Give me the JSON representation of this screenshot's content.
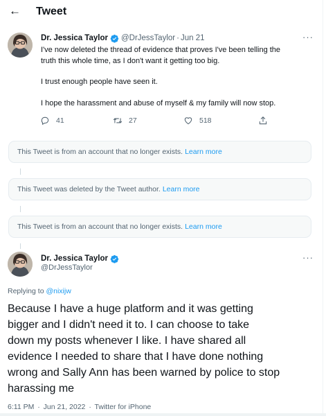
{
  "header": {
    "back_icon": "arrow-left-icon",
    "title": "Tweet"
  },
  "tweet1": {
    "name": "Dr. Jessica Taylor",
    "handle": "@DrJessTaylor",
    "date": "Jun 21",
    "dot": "·",
    "more": "···",
    "lines": [
      "I've now deleted the thread of evidence that proves I've been telling the",
      "truth this whole time, as I don't want it getting too big.",
      "I trust enough people have seen it.",
      "I hope the harassment and abuse of myself & my family will now stop."
    ],
    "replies": "41",
    "retweets": "27",
    "likes": "518"
  },
  "notices": [
    {
      "text": "This Tweet is from an account that no longer exists.",
      "link": "Learn more"
    },
    {
      "text": "This Tweet was deleted by the Tweet author.",
      "link": "Learn more"
    },
    {
      "text": "This Tweet is from an account that no longer exists.",
      "link": "Learn more"
    }
  ],
  "main_tweet": {
    "name": "Dr. Jessica Taylor",
    "handle": "@DrJessTaylor",
    "more": "···",
    "replying_prefix": "Replying to ",
    "replying_to": "@nixijw",
    "lines": [
      "Because I have a huge platform and it was getting",
      "bigger and I didn't need it to. I can choose to take",
      "down my posts whenever I like. I have shared all",
      "evidence I needed to share that I have done nothing",
      "wrong and Sally Ann has been warned by police to stop",
      "harassing me"
    ],
    "time": "6:11 PM",
    "date": "Jun 21, 2022",
    "source": "Twitter for iPhone",
    "dot": "·"
  },
  "colors": {
    "accent": "#1d9bf0",
    "text": "#0f1419",
    "muted": "#536471",
    "notice_bg": "#f7f9f9"
  }
}
